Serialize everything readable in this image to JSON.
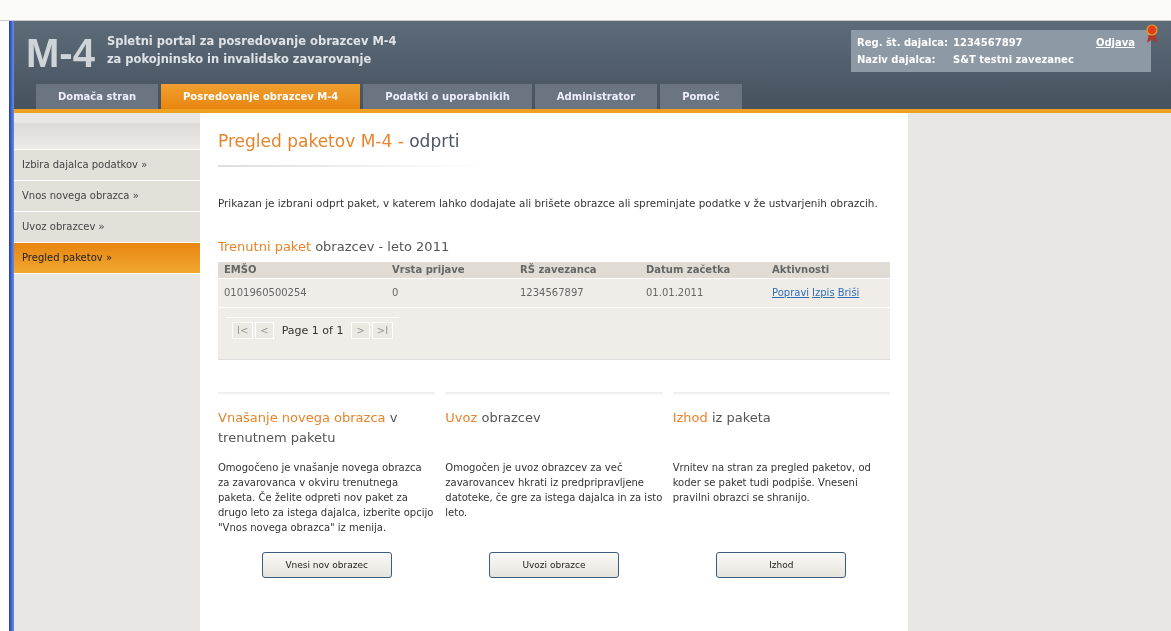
{
  "header": {
    "logo": "M-4",
    "title_lines": [
      "Spletni portal za posredovanje obrazcev M-4",
      "za pokojninsko in invalidsko zavarovanje"
    ],
    "user_box": {
      "reg_label": "Reg. št. dajalca:",
      "reg_value": "1234567897",
      "name_label": "Naziv dajalca:",
      "name_value": "S&T testni zavezanec",
      "logout": "Odjava"
    }
  },
  "tabs": [
    {
      "label": "Domača stran",
      "selected": false
    },
    {
      "label": "Posredovanje obrazcev M-4",
      "selected": true
    },
    {
      "label": "Podatki o uporabnikih",
      "selected": false
    },
    {
      "label": "Administrator",
      "selected": false
    },
    {
      "label": "Pomoč",
      "selected": false
    }
  ],
  "sidebar": {
    "items": [
      {
        "label": "Izbira dajalca podatkov »",
        "selected": false
      },
      {
        "label": "Vnos novega obrazca »",
        "selected": false
      },
      {
        "label": "Uvoz obrazcev »",
        "selected": false
      },
      {
        "label": "Pregled paketov »",
        "selected": true
      }
    ]
  },
  "page_title": {
    "accent": "Pregled paketov M-4 -",
    "rest": "odprti"
  },
  "intro": "Prikazan je izbrani odprt paket, v katerem lahko dodajate ali brišete obrazce ali spreminjate podatke v že ustvarjenih obrazcih.",
  "section_title": {
    "accent": "Trenutni paket",
    "rest": "obrazcev - leto 2011"
  },
  "table": {
    "columns": [
      "EMŠO",
      "Vrsta prijave",
      "RŠ zavezanca",
      "Datum začetka",
      "Aktivnosti"
    ],
    "rows": [
      {
        "cells": [
          "0101960500254",
          "0",
          "1234567897",
          "01.01.2011"
        ],
        "actions": [
          "Popravi",
          "Izpis",
          "Briši"
        ]
      }
    ]
  },
  "pager": {
    "first": "I<",
    "prev": "<",
    "text": "Page 1 of 1",
    "next": ">",
    "last": ">I"
  },
  "panels": [
    {
      "accent": "Vnašanje novega obrazca",
      "rest": "v trenutnem paketu",
      "text": "Omogočeno je vnašanje novega obrazca za zavarovanca v okviru trenutnega paketa. Če želite odpreti nov paket za drugo leto za istega dajalca, izberite opcijo \"Vnos novega obrazca\" iz menija.",
      "button": "Vnesi nov obrazec"
    },
    {
      "accent": "Uvoz",
      "rest": "obrazcev",
      "text": "Omogočen je uvoz obrazcev za več zavarovancev hkrati iz predpripravljene datoteke, če gre za istega dajalca in za isto leto.",
      "button": "Uvozi obrazce"
    },
    {
      "accent": "Izhod",
      "rest": "iz paketa",
      "text": "Vrnitev na stran za pregled paketov, od koder se paket tudi podpiše. Vneseni pravilni obrazci se shranijo.",
      "button": "Izhod"
    }
  ]
}
